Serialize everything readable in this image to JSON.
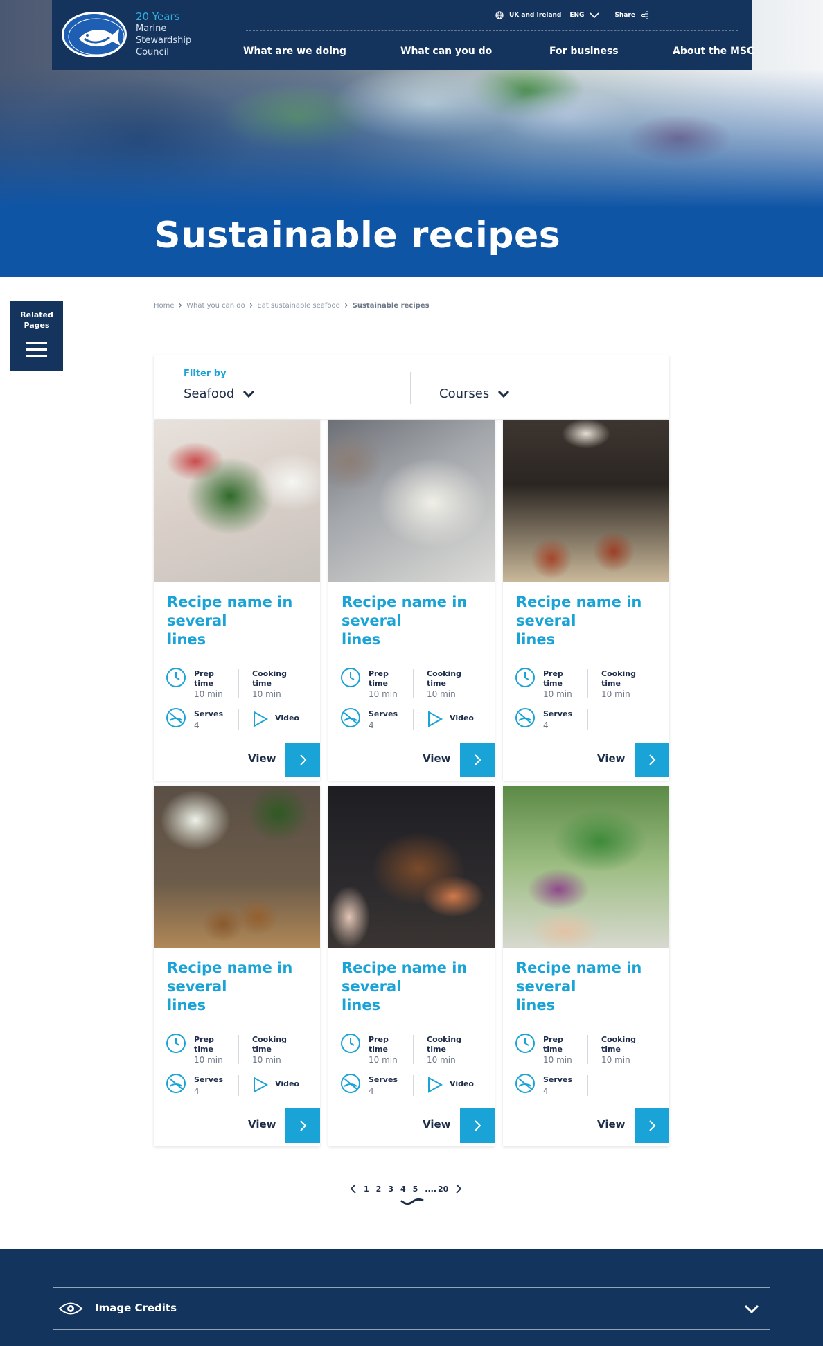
{
  "header": {
    "logo_years": "20 Years",
    "logo_name": [
      "Marine",
      "Stewardship",
      "Council"
    ],
    "region": "UK and Ireland",
    "language": "ENG",
    "share": "Share",
    "nav": [
      {
        "label": "What are we doing"
      },
      {
        "label": "What can you do"
      },
      {
        "label": "For business"
      },
      {
        "label": "About the MSC"
      }
    ]
  },
  "hero": {
    "title": "Sustainable recipes"
  },
  "related": {
    "label_line1": "Related",
    "label_line2": "Pages"
  },
  "breadcrumb": [
    "Home",
    "What you can do",
    "Eat sustainable seafood",
    "Sustainable recipes"
  ],
  "filter": {
    "label": "Filter by",
    "seafood": "Seafood",
    "courses": "Courses"
  },
  "cards": [
    {
      "title_lines": [
        "Recipe name in",
        "several",
        "lines"
      ],
      "prep_label": [
        "Prep",
        "time"
      ],
      "prep": "10 min",
      "cook_label": [
        "Cooking",
        "time"
      ],
      "cook": "10 min",
      "serves_label": "Serves",
      "serves": "4",
      "video": "Video",
      "view": "View"
    },
    {
      "title_lines": [
        "Recipe name in",
        "several",
        "lines"
      ],
      "prep_label": [
        "Prep",
        "time"
      ],
      "prep": "10 min",
      "cook_label": [
        "Cooking",
        "time"
      ],
      "cook": "10 min",
      "serves_label": "Serves",
      "serves": "4",
      "video": "Video",
      "view": "View"
    },
    {
      "title_lines": [
        "Recipe name in",
        "several",
        "lines"
      ],
      "prep_label": [
        "Prep",
        "time"
      ],
      "prep": "10 min",
      "cook_label": [
        "Cooking",
        "time"
      ],
      "cook": "10 min",
      "serves_label": "Serves",
      "serves": "4",
      "video": "",
      "view": "View"
    },
    {
      "title_lines": [
        "Recipe name in",
        "several",
        "lines"
      ],
      "prep_label": [
        "Prep",
        "time"
      ],
      "prep": "10 min",
      "cook_label": [
        "Cooking",
        "time"
      ],
      "cook": "10 min",
      "serves_label": "Serves",
      "serves": "4",
      "video": "Video",
      "view": "View"
    },
    {
      "title_lines": [
        "Recipe name in",
        "several",
        "lines"
      ],
      "prep_label": [
        "Prep",
        "time"
      ],
      "prep": "10 min",
      "cook_label": [
        "Cooking",
        "time"
      ],
      "cook": "10 min",
      "serves_label": "Serves",
      "serves": "4",
      "video": "Video",
      "view": "View"
    },
    {
      "title_lines": [
        "Recipe name in",
        "several",
        "lines"
      ],
      "prep_label": [
        "Prep",
        "time"
      ],
      "prep": "10 min",
      "cook_label": [
        "Cooking",
        "time"
      ],
      "cook": "10 min",
      "serves_label": "Serves",
      "serves": "4",
      "video": "",
      "view": "View"
    }
  ],
  "pagination": {
    "pages": [
      "1",
      "2",
      "3",
      "4",
      "5"
    ],
    "ellipsis": "....",
    "last": "20"
  },
  "footer": {
    "credits": "Image Credits"
  },
  "colors": {
    "navy": "#14345e",
    "accent": "#1aa3d6",
    "hero_blue": "#0f55a6"
  }
}
